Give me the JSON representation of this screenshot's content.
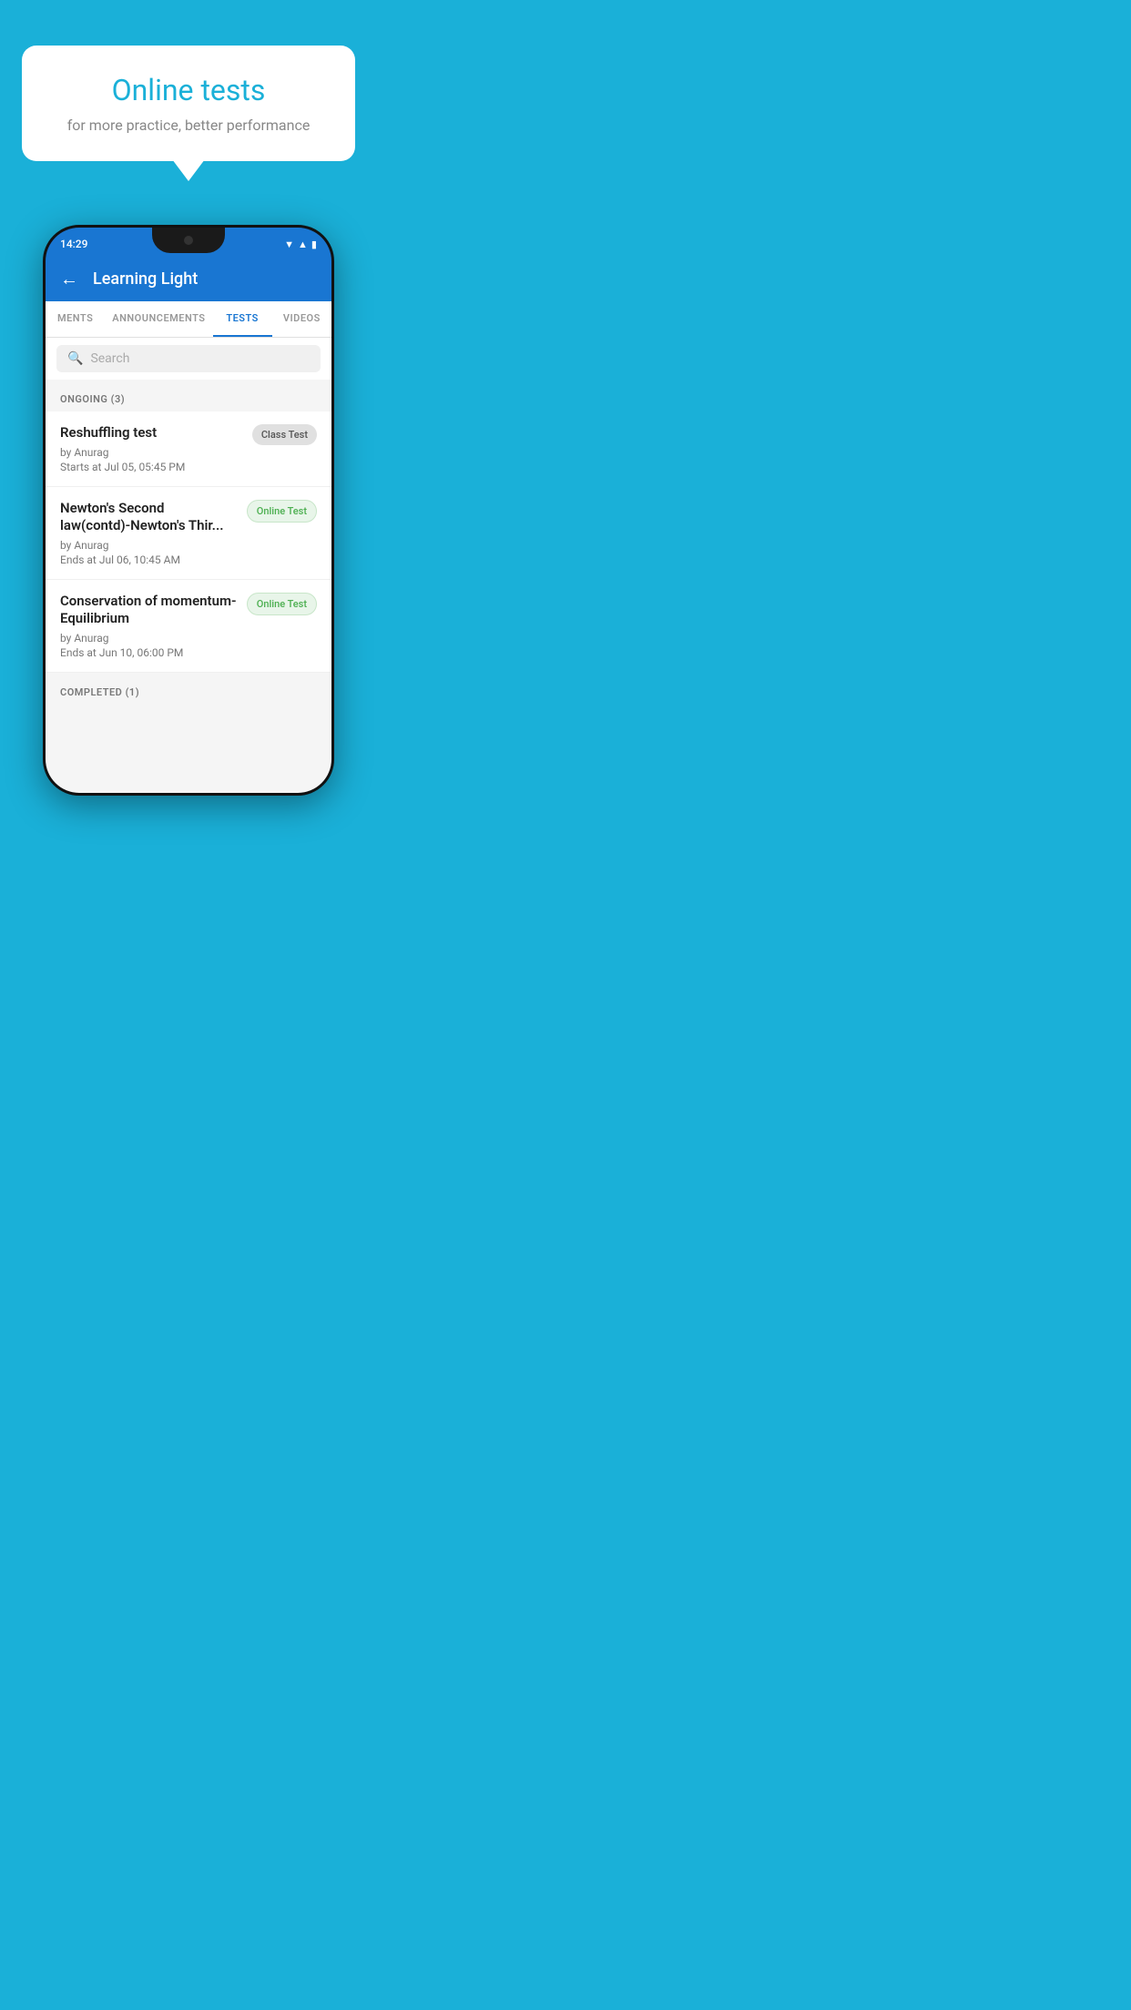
{
  "background_color": "#1ab0d8",
  "speech_bubble": {
    "title": "Online tests",
    "subtitle": "for more practice, better performance"
  },
  "phone": {
    "status_bar": {
      "time": "14:29",
      "icons": [
        "wifi",
        "signal",
        "battery"
      ]
    },
    "app_bar": {
      "title": "Learning Light",
      "back_label": "←"
    },
    "tabs": [
      {
        "label": "MENTS",
        "active": false
      },
      {
        "label": "ANNOUNCEMENTS",
        "active": false
      },
      {
        "label": "TESTS",
        "active": true
      },
      {
        "label": "VIDEOS",
        "active": false
      }
    ],
    "search": {
      "placeholder": "Search"
    },
    "ongoing_section": {
      "label": "ONGOING (3)"
    },
    "tests": [
      {
        "title": "Reshuffling test",
        "author": "by Anurag",
        "time_label": "Starts at",
        "time": "Jul 05, 05:45 PM",
        "badge": "Class Test",
        "badge_type": "class"
      },
      {
        "title": "Newton's Second law(contd)-Newton's Thir...",
        "author": "by Anurag",
        "time_label": "Ends at",
        "time": "Jul 06, 10:45 AM",
        "badge": "Online Test",
        "badge_type": "online"
      },
      {
        "title": "Conservation of momentum-Equilibrium",
        "author": "by Anurag",
        "time_label": "Ends at",
        "time": "Jun 10, 06:00 PM",
        "badge": "Online Test",
        "badge_type": "online"
      }
    ],
    "completed_section": {
      "label": "COMPLETED (1)"
    }
  }
}
